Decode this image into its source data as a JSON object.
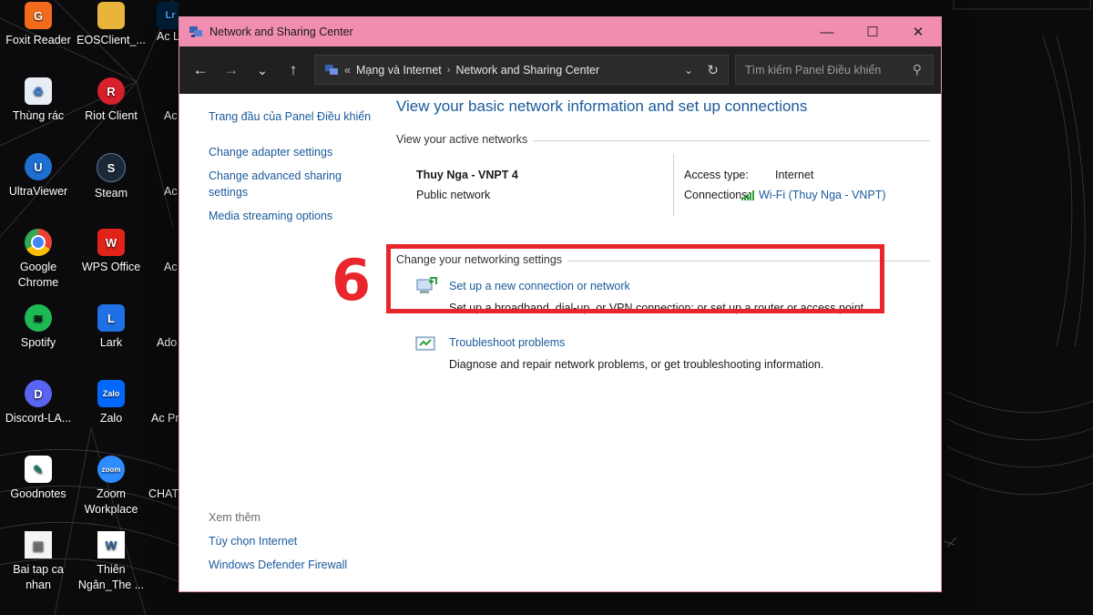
{
  "desktop": {
    "icons": [
      {
        "label": "Foxit Reader",
        "color": "#f26b1d",
        "glyph": "G",
        "round": false
      },
      {
        "label": "EOSClient_...",
        "color": "#e8b43a",
        "glyph": "",
        "round": false
      },
      {
        "label": "Thùng rác",
        "color": "#3a7bd5",
        "glyph": "♻",
        "round": false
      },
      {
        "label": "Riot Client",
        "color": "#d6202a",
        "glyph": "R",
        "round": true
      },
      {
        "label": "UltraViewer",
        "color": "#1f6fd0",
        "glyph": "U",
        "round": true
      },
      {
        "label": "Steam",
        "color": "#1b2838",
        "glyph": "S",
        "round": true
      },
      {
        "label": "Google Chrome",
        "color": "#e8453c",
        "glyph": "●",
        "round": true
      },
      {
        "label": "WPS Office",
        "color": "#e2231a",
        "glyph": "W",
        "round": false
      },
      {
        "label": "Spotify",
        "color": "#1db954",
        "glyph": "≋",
        "round": true
      },
      {
        "label": "Lark",
        "color": "#1f6fe5",
        "glyph": "L",
        "round": false
      },
      {
        "label": "Discord-LA...",
        "color": "#5865f2",
        "glyph": "D",
        "round": true
      },
      {
        "label": "Zalo",
        "color": "#0068ff",
        "glyph": "Zalo",
        "round": false
      },
      {
        "label": "Goodnotes",
        "color": "#ffffff",
        "glyph": "✎",
        "round": false
      },
      {
        "label": "Zoom Workplace",
        "color": "#2d8cff",
        "glyph": "zoom",
        "round": true
      },
      {
        "label": "Bai tap ca nhan",
        "color": "#f4f4f4",
        "glyph": "▤",
        "round": false
      },
      {
        "label": "Thiên Ngân_The ...",
        "color": "#2b579a",
        "glyph": "W",
        "round": false
      }
    ],
    "partial_labels": [
      "Ac Ligh",
      "Ac Au",
      "Ac Pho",
      "Ac Illus",
      "Ado",
      "Ac Prem",
      "CHAT DV S"
    ]
  },
  "window": {
    "title": "Network and Sharing Center",
    "controls": {
      "minimize": "—",
      "maximize": "☐",
      "close": "✕"
    },
    "nav": {
      "back": "←",
      "forward": "→",
      "recent": "⌄",
      "up": "↑"
    },
    "address": {
      "overflow": "«",
      "crumbs": [
        "Mạng và Internet",
        "Network and Sharing Center"
      ],
      "dropdown": "⌄",
      "refresh": "↻"
    },
    "search": {
      "placeholder": "Tìm kiếm Panel Điều khiển",
      "icon": "⚲"
    }
  },
  "left_pane": {
    "home_link": "Trang đầu của Panel Điều khiển",
    "links": [
      "Change adapter settings",
      "Change advanced sharing settings",
      "Media streaming options"
    ],
    "see_also_heading": "Xem thêm",
    "see_also": [
      "Tùy chọn Internet",
      "Windows Defender Firewall"
    ]
  },
  "main": {
    "title": "View your basic network information and set up connections",
    "active_networks_heading": "View your active networks",
    "network": {
      "name": "Thuy Nga - VNPT 4",
      "category": "Public network",
      "access_type_label": "Access type:",
      "access_type_value": "Internet",
      "connections_label": "Connections:",
      "connections_value": "Wi-Fi (Thuy Nga - VNPT)"
    },
    "change_settings_heading": "Change your networking settings",
    "tasks": [
      {
        "title": "Set up a new connection or network",
        "desc": "Set up a broadband, dial-up, or VPN connection; or set up a router or access point."
      },
      {
        "title": "Troubleshoot problems",
        "desc": "Diagnose and repair network problems, or get troubleshooting information."
      }
    ]
  },
  "annotation": {
    "step_number": "6",
    "color": "#e8262c"
  },
  "colors": {
    "titlebar": "#f08db0",
    "link": "#1a5a9c",
    "navbar": "#202020"
  }
}
